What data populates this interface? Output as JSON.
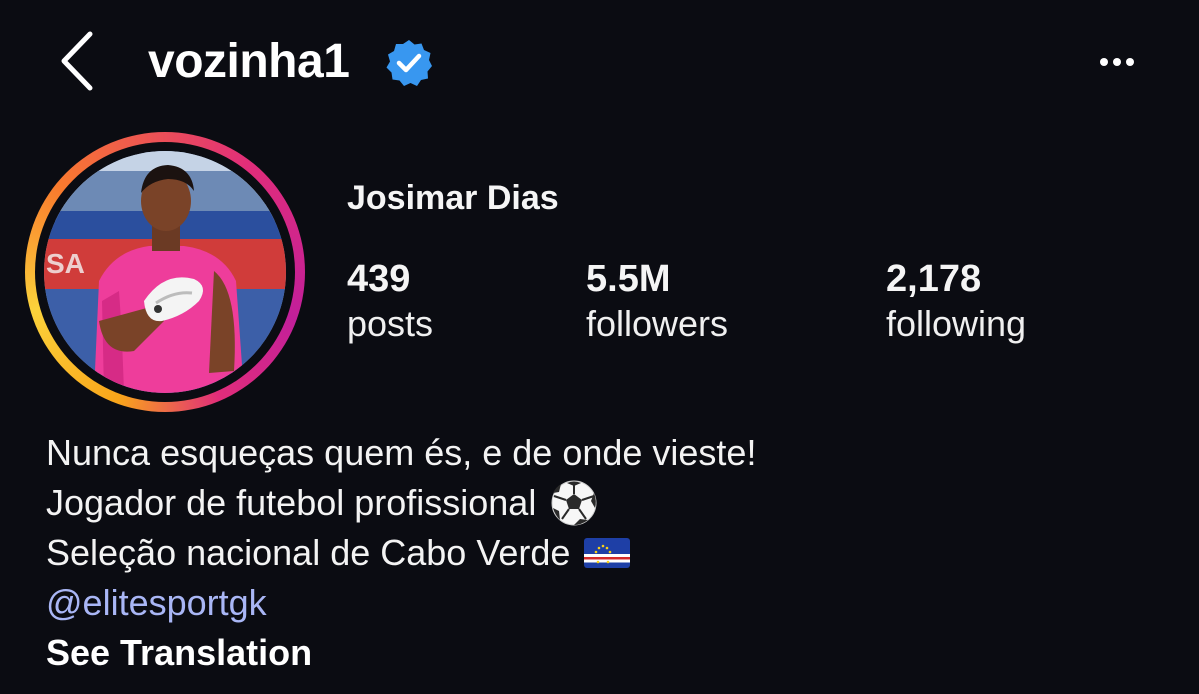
{
  "header": {
    "username": "vozinha1",
    "verified": true,
    "back_icon": "chevron-left-icon",
    "more_icon": "more-horizontal-icon",
    "verified_color": "#3897f0"
  },
  "profile": {
    "display_name": "Josimar Dias",
    "story_ring_colors": [
      "#f9a51a",
      "#e12d7a",
      "#c21f9a"
    ]
  },
  "stats": [
    {
      "value": "439",
      "label": "posts"
    },
    {
      "value": "5.5M",
      "label": "followers"
    },
    {
      "value": "2,178",
      "label": "following"
    }
  ],
  "bio": {
    "lines": [
      "Nunca esqueças quem és, e de onde vieste!",
      "Jogador de futebol profissional",
      "Seleção nacional de Cabo Verde"
    ],
    "line_emojis": [
      "",
      "soccer-ball-icon",
      "cape-verde-flag-icon"
    ],
    "mention": "@elitesportgk",
    "mention_color": "#a9b6f5",
    "see_translation": "See Translation"
  }
}
